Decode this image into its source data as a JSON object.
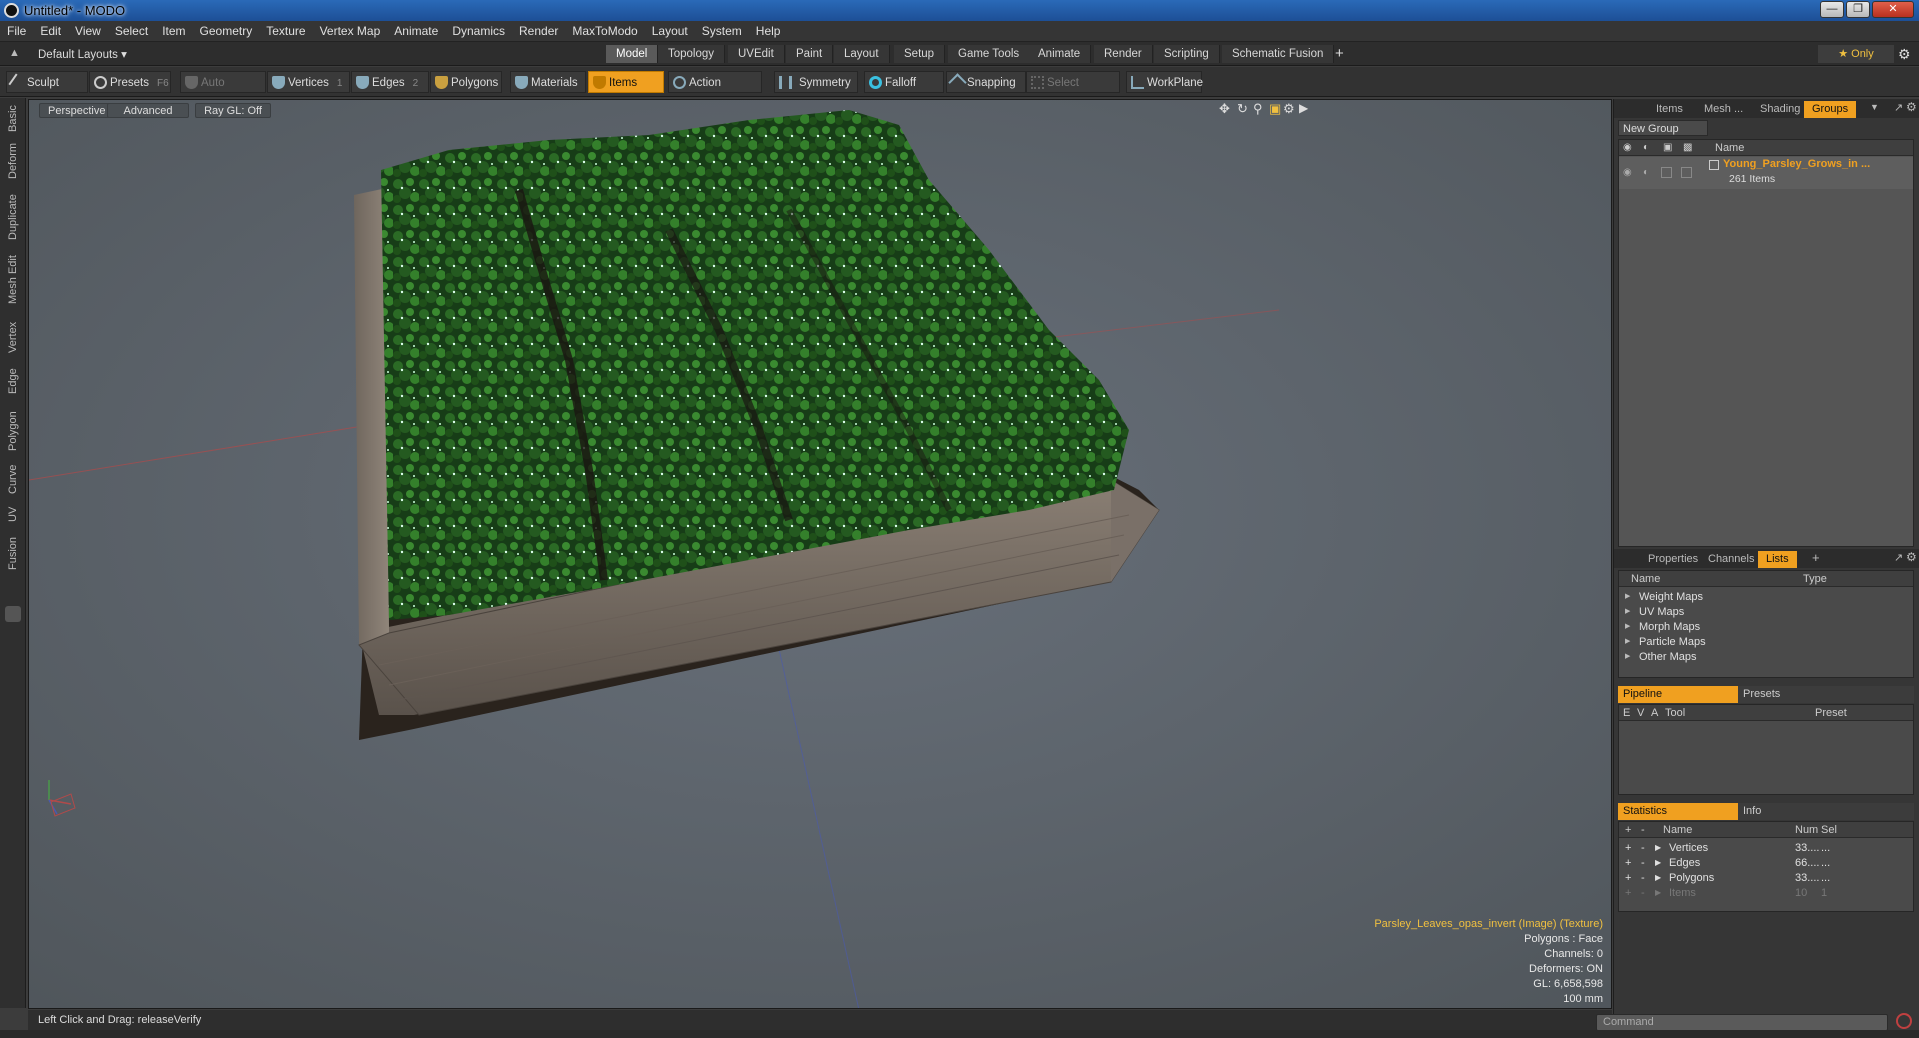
{
  "window": {
    "title": "Untitled* - MODO"
  },
  "menu": [
    "File",
    "Edit",
    "View",
    "Select",
    "Item",
    "Geometry",
    "Texture",
    "Vertex Map",
    "Animate",
    "Dynamics",
    "Render",
    "MaxToModo",
    "Layout",
    "System",
    "Help"
  ],
  "layoutbar": {
    "layout_dropdown": "Default Layouts ▾",
    "tabs": [
      "Model",
      "Topology",
      "UVEdit",
      "Paint",
      "Layout",
      "Setup",
      "Game Tools",
      "Animate",
      "Render",
      "Scripting",
      "Schematic Fusion"
    ],
    "active_tab": "Model",
    "plus": "+",
    "only_label": "★ Only"
  },
  "toolbar": {
    "sculpt": "Sculpt",
    "presets": "Presets",
    "presets_key": "F6",
    "auto_select": "Auto Select",
    "vertices": "Vertices",
    "vertices_key": "1",
    "edges": "Edges",
    "edges_key": "2",
    "polygons": "Polygons",
    "materials": "Materials",
    "items": "Items",
    "action_center": "Action Center",
    "symmetry": "Symmetry",
    "falloff": "Falloff",
    "snapping": "Snapping",
    "select_through": "Select Through",
    "workplane": "WorkPlane"
  },
  "left_tabs": [
    "Basic",
    "Deform",
    "Duplicate",
    "Mesh Edit",
    "Vertex",
    "Edge",
    "Polygon",
    "Curve",
    "UV",
    "Fusion"
  ],
  "viewport": {
    "perspective": "Perspective",
    "advanced": "Advanced",
    "raygl": "Ray GL: Off",
    "info": {
      "texture": "Parsley_Leaves_opas_invert (Image) (Texture)",
      "polygons": "Polygons : Face",
      "channels": "Channels: 0",
      "deformers": "Deformers: ON",
      "gl": "GL: 6,658,598",
      "scale": "100 mm"
    }
  },
  "statusbar": {
    "text": "Left Click and Drag:   releaseVerify"
  },
  "right_panel": {
    "top_tabs": [
      "Items",
      "Mesh ...",
      "Shading",
      "Groups"
    ],
    "active_top_tab": "Groups",
    "new_group": "New Group",
    "name_header": "Name",
    "group_name": "Young_Parsley_Grows_in ...",
    "group_count": "261 Items",
    "mid_tabs": [
      "Properties",
      "Channels",
      "Lists"
    ],
    "active_mid_tab": "Lists",
    "lists_headers": {
      "name": "Name",
      "type": "Type"
    },
    "lists_items": [
      "Weight Maps",
      "UV Maps",
      "Morph Maps",
      "Particle Maps",
      "Other Maps"
    ],
    "pipeline_tab": "Pipeline",
    "presets_tab": "Presets",
    "pipeline_headers": {
      "e": "E",
      "v": "V",
      "a": "A",
      "tool": "Tool",
      "preset": "Preset"
    },
    "statistics_tab": "Statistics",
    "info_tab": "Info",
    "stats_headers": {
      "name": "Name",
      "num": "Num",
      "sel": "Sel"
    },
    "stats_rows": [
      {
        "name": "Vertices",
        "num": "33....",
        "sel": "..."
      },
      {
        "name": "Edges",
        "num": "66....",
        "sel": "..."
      },
      {
        "name": "Polygons",
        "num": "33....",
        "sel": "..."
      },
      {
        "name": "Items",
        "num": "10",
        "sel": "1"
      }
    ],
    "command_placeholder": "Command"
  },
  "colors": {
    "accent": "#f0a020",
    "viewport_bg": "#5a6166",
    "panel_bg": "#363636"
  }
}
